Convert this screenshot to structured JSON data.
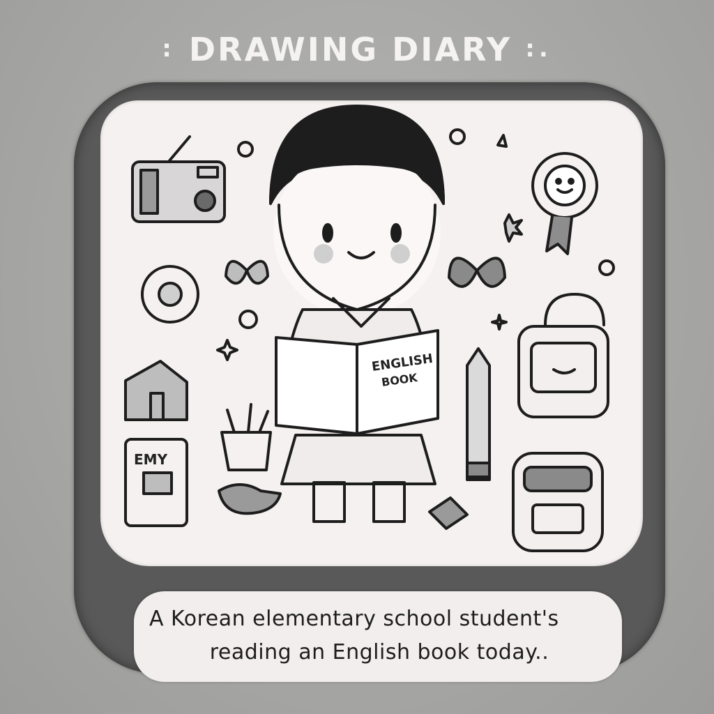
{
  "header": {
    "title": "DRAWING DIARY",
    "deco_left": ":",
    "deco_right": ":."
  },
  "illustration": {
    "book_cover_line1": "ENGLISH",
    "book_cover_line2": "BOOK",
    "small_book_label": "EMY"
  },
  "caption": {
    "line1": "A Korean elementary school student's",
    "line2": "reading an English book today.."
  },
  "colors": {
    "background": "#a9a9a7",
    "frame": "#595959",
    "paper": "#f6f1f1",
    "ink": "#1d1d1d",
    "title": "#f5f3f2"
  }
}
